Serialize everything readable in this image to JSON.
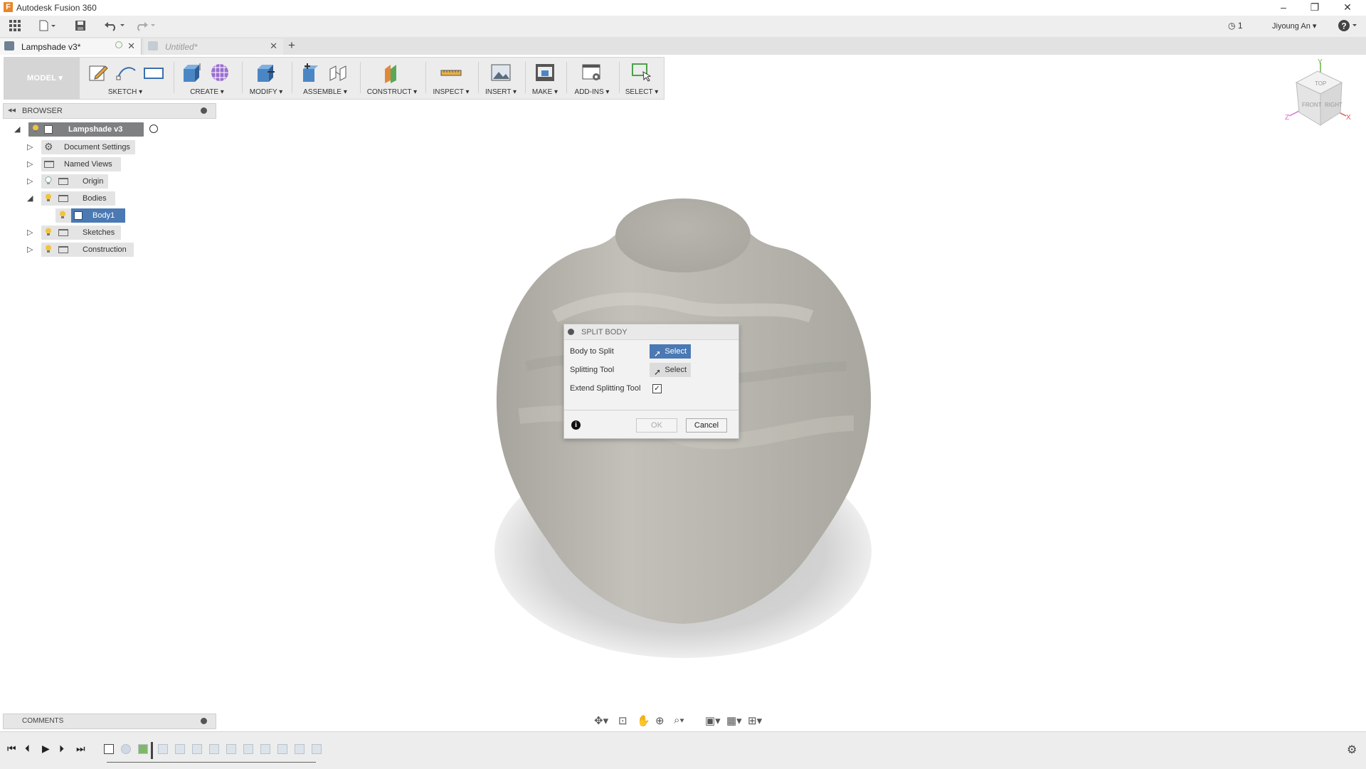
{
  "app": {
    "title": "Autodesk Fusion 360",
    "logo_letter": "F",
    "window_controls": [
      "–",
      "❐",
      "✕"
    ]
  },
  "quick_access": {
    "jobs_count": "1",
    "user_name": "Jiyoung An ▾",
    "help": "?"
  },
  "tabs": [
    {
      "label": "Lampshade v3*",
      "active": true
    },
    {
      "label": "Untitled*",
      "active": false
    }
  ],
  "toolbar": {
    "workspace": "MODEL ▾",
    "groups": [
      {
        "label": "SKETCH ▾"
      },
      {
        "label": "CREATE ▾"
      },
      {
        "label": "MODIFY ▾"
      },
      {
        "label": "ASSEMBLE ▾"
      },
      {
        "label": "CONSTRUCT ▾"
      },
      {
        "label": "INSPECT ▾"
      },
      {
        "label": "INSERT ▾"
      },
      {
        "label": "MAKE ▾"
      },
      {
        "label": "ADD-INS ▾"
      },
      {
        "label": "SELECT ▾"
      }
    ]
  },
  "viewcube": {
    "faces": [
      "TOP",
      "FRONT",
      "RIGHT"
    ],
    "axes": [
      "Y",
      "Z",
      "X"
    ]
  },
  "browser": {
    "title": "BROWSER",
    "root": "Lampshade v3",
    "nodes": [
      {
        "label": "Document Settings"
      },
      {
        "label": "Named Views"
      },
      {
        "label": "Origin"
      },
      {
        "label": "Bodies"
      },
      {
        "label": "Body1"
      },
      {
        "label": "Sketches"
      },
      {
        "label": "Construction"
      }
    ]
  },
  "dialog": {
    "title": "SPLIT BODY",
    "rows": [
      {
        "label": "Body to Split",
        "button": "Select"
      },
      {
        "label": "Splitting Tool",
        "button": "Select"
      },
      {
        "label": "Extend Splitting Tool",
        "checked": true
      }
    ],
    "ok_label": "OK",
    "cancel_label": "Cancel",
    "info": "i",
    "check_mark": "✓"
  },
  "comments": {
    "title": "COMMENTS"
  },
  "colors": {
    "accent": "#4a79b3",
    "body_fill": "#b8b6ae",
    "bulb": "#f3c33c"
  }
}
